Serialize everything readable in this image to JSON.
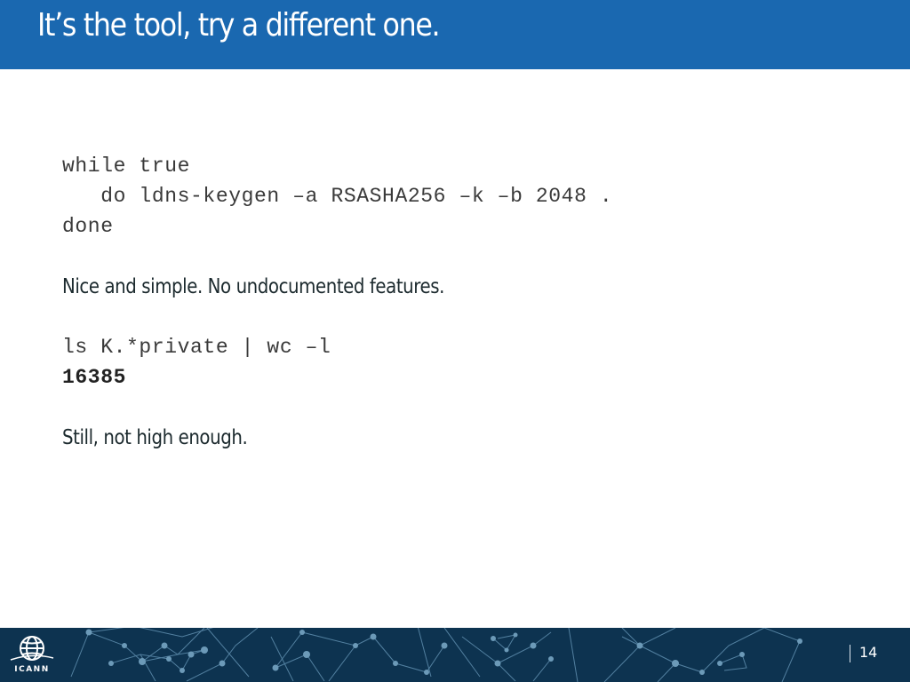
{
  "header": {
    "title": "It’s the tool, try a different one."
  },
  "content": {
    "code_block_1": [
      "while true",
      "   do ldns-keygen –a RSASHA256 –k –b 2048 .",
      "done"
    ],
    "text_1": "Nice and simple. No undocumented features.",
    "code_block_2": {
      "command": "ls K.*private | wc –l",
      "output": "16385"
    },
    "text_2": "Still, not high enough."
  },
  "footer": {
    "logo_label": "ICANN",
    "logo_icon": "globe-icon",
    "page_number": "14"
  },
  "colors": {
    "header_bg": "#1a68b0",
    "footer_bg": "#0d3350",
    "network_lines": "#6c9ab8"
  }
}
